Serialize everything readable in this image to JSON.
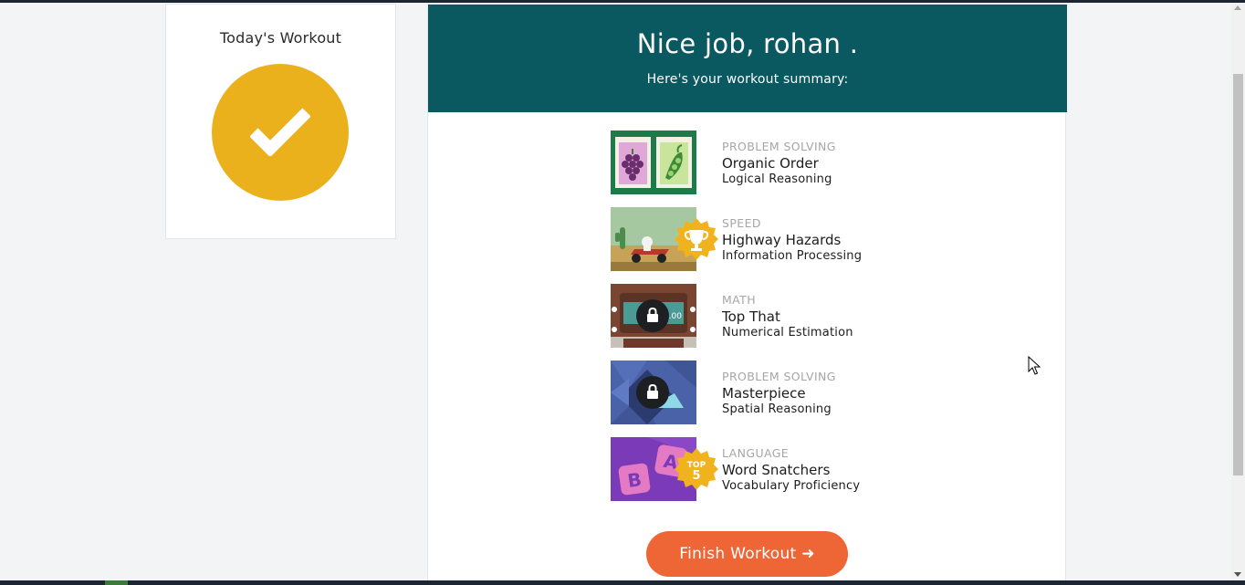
{
  "today": {
    "title": "Today's Workout",
    "status_icon": "checkmark-icon",
    "circle_color": "#ebb11d"
  },
  "summary": {
    "title": "Nice job, rohan .",
    "subtitle": "Here's your workout summary:",
    "header_color": "#0a5860"
  },
  "games": [
    {
      "category": "PROBLEM SOLVING",
      "name": "Organic Order",
      "skill": "Logical Reasoning",
      "badge": "none"
    },
    {
      "category": "SPEED",
      "name": "Highway Hazards",
      "skill": "Information Processing",
      "badge": "trophy-icon"
    },
    {
      "category": "MATH",
      "name": "Top That",
      "skill": "Numerical Estimation",
      "badge": "lock-icon"
    },
    {
      "category": "PROBLEM SOLVING",
      "name": "Masterpiece",
      "skill": "Spatial Reasoning",
      "badge": "lock-icon"
    },
    {
      "category": "LANGUAGE",
      "name": "Word Snatchers",
      "skill": "Vocabulary Proficiency",
      "badge": "top-5-badge",
      "badge_text_top": "TOP",
      "badge_text_num": "5"
    }
  ],
  "thumb_text": {
    "top_that_readout": ".00",
    "word_letter_b": "B",
    "word_letter_a": "A"
  },
  "finish": {
    "label": "Finish Workout ➜",
    "color": "#ee6536"
  }
}
